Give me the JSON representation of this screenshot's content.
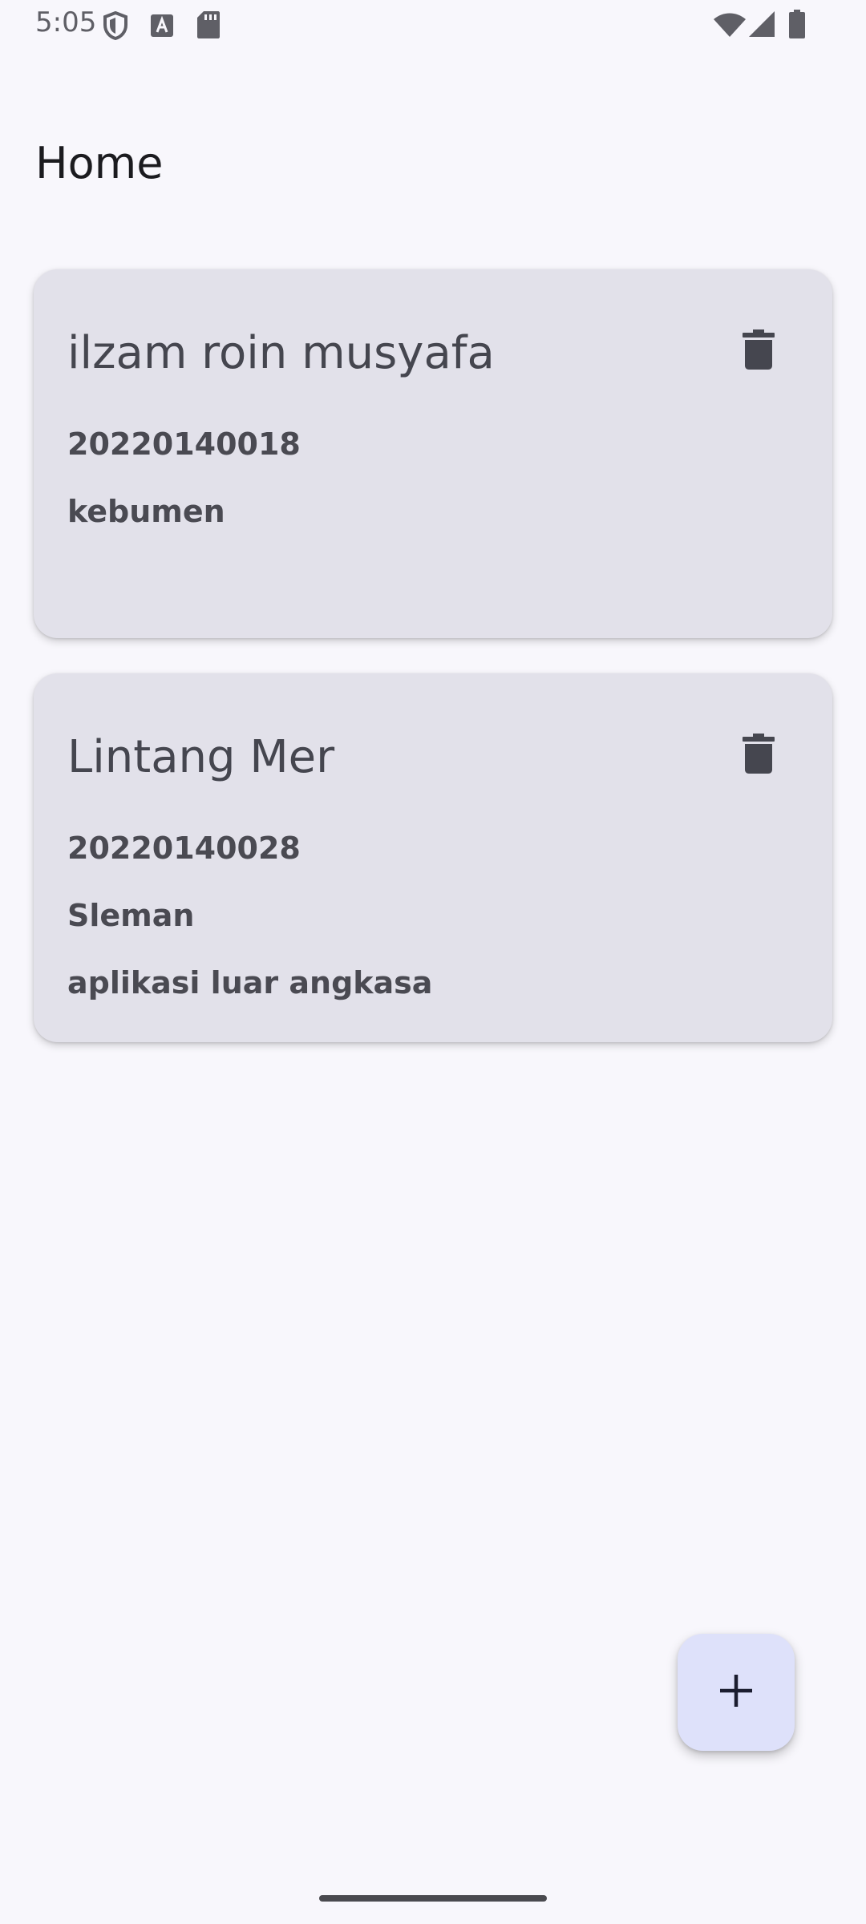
{
  "status_bar": {
    "time": "5:05",
    "icons": [
      "shield-icon",
      "font-a-icon",
      "sd-card-icon",
      "wifi-icon",
      "signal-icon",
      "battery-icon"
    ]
  },
  "header": {
    "title": "Home"
  },
  "cards": [
    {
      "name": "ilzam roin musyafa",
      "nim": "20220140018",
      "address": "kebumen",
      "note": ""
    },
    {
      "name": "Lintang Mer",
      "nim": "20220140028",
      "address": "Sleman",
      "note": "aplikasi luar angkasa"
    }
  ],
  "fab": {
    "icon": "plus-icon"
  },
  "colors": {
    "background": "#f8f7fc",
    "card": "#e2e1ea",
    "fab": "#dee1fa",
    "text_primary": "#1b1b1f",
    "text_secondary": "#45464f"
  }
}
